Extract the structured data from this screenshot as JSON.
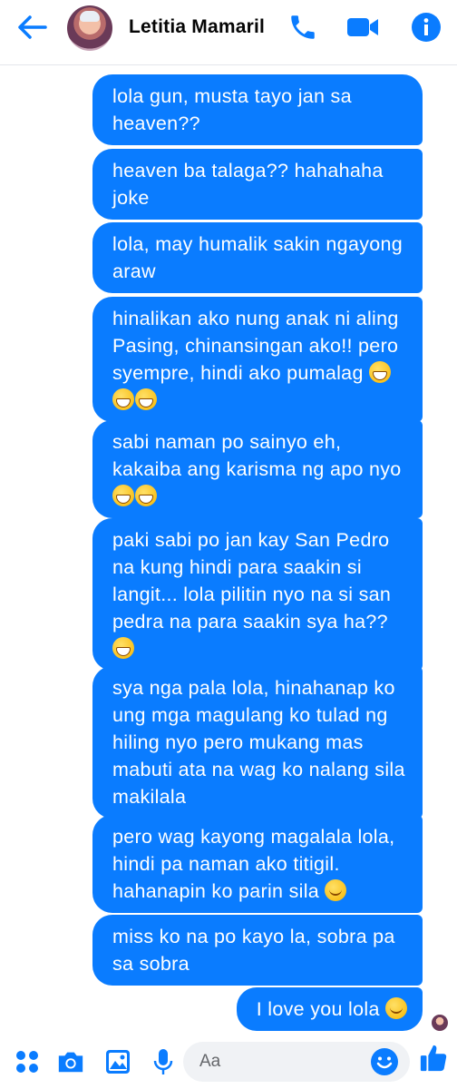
{
  "header": {
    "contact_name": "Letitia Mamaril"
  },
  "icons": {
    "back": "back-arrow-icon",
    "call": "phone-icon",
    "video": "video-camera-icon",
    "info": "info-icon",
    "menu": "four-dots-icon",
    "camera": "camera-icon",
    "gallery": "image-icon",
    "mic": "microphone-icon",
    "emoji": "smiley-icon",
    "like": "thumbs-up-icon"
  },
  "colors": {
    "accent": "#0a7cff",
    "bubble_text": "#ffffff"
  },
  "messages": [
    "lola gun, musta tayo jan sa heaven??",
    "heaven ba talaga?? hahahaha joke",
    "lola, may humalik sakin ngayong araw",
    "hinalikan ako nung anak ni aling Pasing, chinansingan ako!! pero syempre, hindi ako pumalag",
    "sabi naman po sainyo eh, kakaiba ang karisma ng apo nyo",
    "paki sabi po jan kay San Pedro na kung hindi para saakin si langit... lola pilitin nyo na si san pedra na para saakin sya ha??",
    "sya nga pala lola, hinahanap ko ung mga magulang ko tulad ng hiling nyo pero mukang mas mabuti ata na wag ko nalang sila makilala",
    "pero wag kayong magalala lola, hindi pa naman ako titigil. hahanapin ko parin sila",
    "miss ko na po kayo la, sobra pa sa sobra",
    "I love you lola"
  ],
  "composer": {
    "placeholder": "Aa"
  }
}
